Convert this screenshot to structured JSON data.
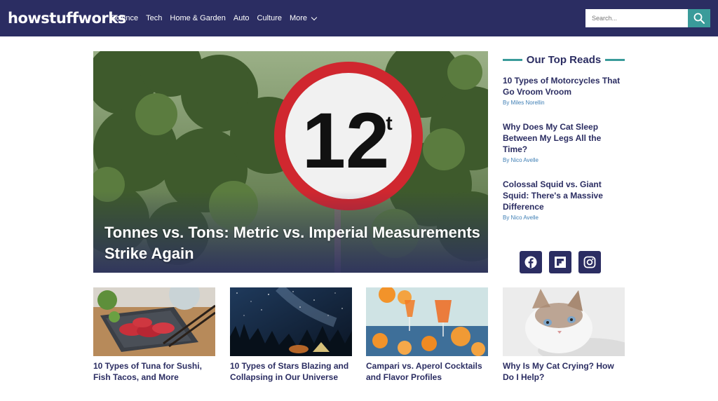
{
  "header": {
    "logo": "howstuffworks",
    "nav": [
      "Science",
      "Tech",
      "Home & Garden",
      "Auto",
      "Culture"
    ],
    "more_label": "More",
    "search_placeholder": "Search...",
    "bg_color": "#2b2d62",
    "accent_color": "#3a9b9a"
  },
  "hero": {
    "title": "Tonnes vs. Tons: Metric vs. Imperial Measurements Strike Again",
    "sign_number": "12",
    "sign_unit": "t"
  },
  "sidebar": {
    "heading": "Our Top Reads",
    "items": [
      {
        "title": "10 Types of Motorcycles That Go Vroom Vroom",
        "byline": "By Miles Norellin"
      },
      {
        "title": "Why Does My Cat Sleep Between My Legs All the Time?",
        "byline": "By Nico Avelle"
      },
      {
        "title": "Colossal Squid vs. Giant Squid: There's a Massive Difference",
        "byline": "By Nico Avelle"
      }
    ],
    "social": [
      "facebook-icon",
      "flipboard-icon",
      "instagram-icon"
    ]
  },
  "cards": [
    {
      "title": "10 Types of Tuna for Sushi, Fish Tacos, and More"
    },
    {
      "title": "10 Types of Stars Blazing and Collapsing in Our Universe"
    },
    {
      "title": "Campari vs. Aperol Cocktails and Flavor Profiles"
    },
    {
      "title": "Why Is My Cat Crying? How Do I Help?"
    }
  ]
}
